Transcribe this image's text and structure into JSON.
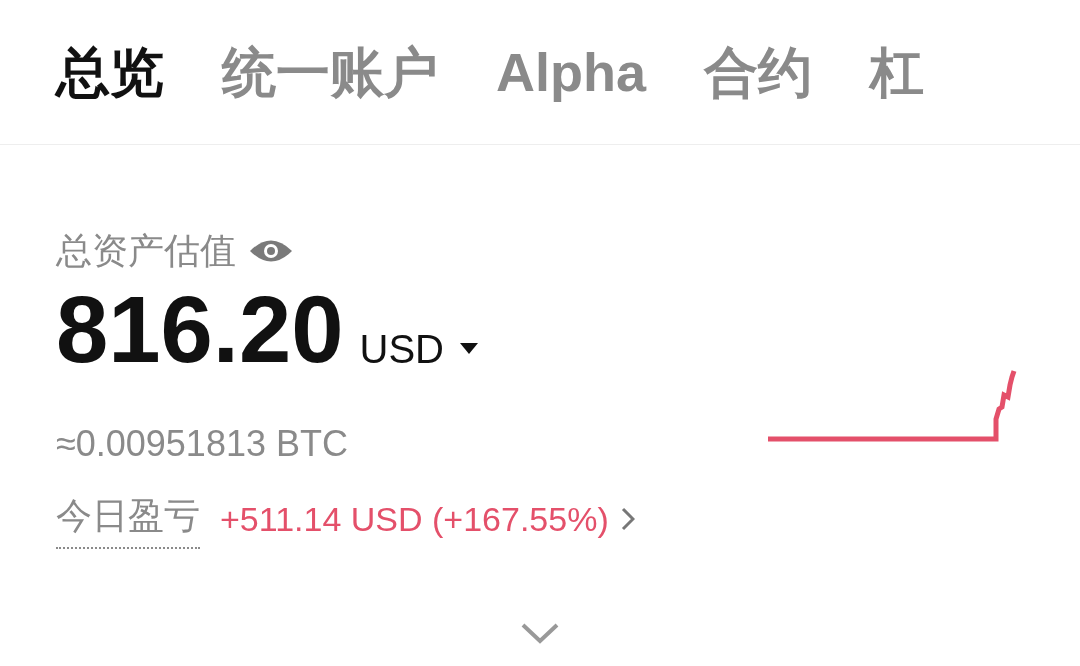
{
  "tabs": [
    {
      "label": "总览",
      "selected": true
    },
    {
      "label": "统一账户",
      "selected": false
    },
    {
      "label": "Alpha",
      "selected": false
    },
    {
      "label": "合约",
      "selected": false
    },
    {
      "label": "杠",
      "selected": false
    }
  ],
  "balance": {
    "label": "总资产估值",
    "amount": "816.20",
    "currency": "USD",
    "btc": "≈0.00951813 BTC"
  },
  "pnl": {
    "label": "今日盈亏",
    "value": "+511.14 USD (+167.55%)"
  }
}
